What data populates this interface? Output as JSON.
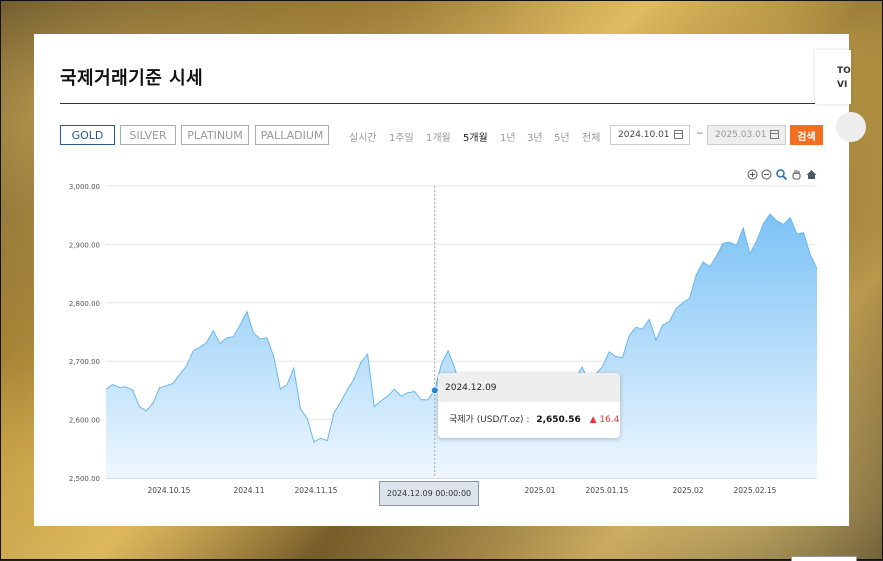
{
  "page": {
    "title": "국제거래기준 시세"
  },
  "metals": [
    {
      "label": "GOLD",
      "active": true
    },
    {
      "label": "SILVER",
      "active": false
    },
    {
      "label": "PLATINUM",
      "active": false
    },
    {
      "label": "PALLADIUM",
      "active": false
    }
  ],
  "periods": [
    {
      "label": "실시간",
      "active": false
    },
    {
      "label": "1주일",
      "active": false
    },
    {
      "label": "1개월",
      "active": false
    },
    {
      "label": "5개월",
      "active": true
    },
    {
      "label": "1년",
      "active": false
    },
    {
      "label": "3년",
      "active": false
    },
    {
      "label": "5년",
      "active": false
    },
    {
      "label": "전체",
      "active": false
    }
  ],
  "date_range": {
    "start": "2024.10.01",
    "end": "2025.03.01",
    "separator": "~"
  },
  "search_label": "검색",
  "side_card": {
    "line1": "TO",
    "line2": "VI"
  },
  "toolbar_icons": [
    "zoom-in-icon",
    "zoom-out-icon",
    "magnify-icon",
    "pan-hand-icon",
    "home-icon"
  ],
  "tooltip": {
    "date": "2024.12.09",
    "label": "국제가 (USD/T.oz)",
    "separator": ":",
    "value": "2,650.56",
    "arrow": "▲",
    "change": "16.4"
  },
  "crosshair_label": "2024.12.09 00:00:00",
  "colors": {
    "accent": "#f26f21",
    "active_tab": "#2c5a88",
    "area_top": "#7cc2f5",
    "area_bottom": "#eef7fe",
    "line": "#6ab7f0",
    "up": "#e53935"
  },
  "chart_data": {
    "type": "area",
    "ylim": [
      2500,
      3000
    ],
    "yticks": [
      "3,000.00",
      "2,900.00",
      "2,800.00",
      "2,700.00",
      "2,600.00",
      "2,500.00"
    ],
    "xticks": [
      "2024.10.15",
      "2024.11",
      "2024.11.15",
      "2024.12.09 00:00:00",
      "2025.01",
      "2025.01.15",
      "2025.02",
      "2025.02.15"
    ],
    "grid": true,
    "series": [
      {
        "x": [
          "2024.10.01",
          "2024.10.02",
          "2024.10.03",
          "2024.10.04",
          "2024.10.07",
          "2024.10.08",
          "2024.10.09",
          "2024.10.10",
          "2024.10.11",
          "2024.10.14",
          "2024.10.15",
          "2024.10.16",
          "2024.10.17",
          "2024.10.18",
          "2024.10.21",
          "2024.10.22",
          "2024.10.23",
          "2024.10.24",
          "2024.10.25",
          "2024.10.28",
          "2024.10.29",
          "2024.10.30",
          "2024.10.31",
          "2024.11.01",
          "2024.11.04",
          "2024.11.05",
          "2024.11.06",
          "2024.11.07",
          "2024.11.08",
          "2024.11.11",
          "2024.11.12",
          "2024.11.13",
          "2024.11.14",
          "2024.11.15",
          "2024.11.18",
          "2024.11.19",
          "2024.11.20",
          "2024.11.21",
          "2024.11.22",
          "2024.11.25",
          "2024.11.26",
          "2024.11.27",
          "2024.11.28",
          "2024.11.29",
          "2024.12.02",
          "2024.12.03",
          "2024.12.04",
          "2024.12.05",
          "2024.12.06",
          "2024.12.09",
          "2024.12.10",
          "2024.12.11",
          "2024.12.12",
          "2024.12.13",
          "2024.12.16",
          "2024.12.17",
          "2024.12.18",
          "2024.12.19",
          "2024.12.20",
          "2024.12.23",
          "2024.12.24",
          "2024.12.26",
          "2024.12.27",
          "2024.12.30",
          "2024.12.31",
          "2025.01.02",
          "2025.01.03",
          "2025.01.06",
          "2025.01.07",
          "2025.01.08",
          "2025.01.09",
          "2025.01.10",
          "2025.01.13",
          "2025.01.14",
          "2025.01.15",
          "2025.01.16",
          "2025.01.17",
          "2025.01.20",
          "2025.01.21",
          "2025.01.22",
          "2025.01.23",
          "2025.01.24",
          "2025.01.27",
          "2025.01.28",
          "2025.01.29",
          "2025.01.30",
          "2025.01.31",
          "2025.02.03",
          "2025.02.04",
          "2025.02.05",
          "2025.02.06",
          "2025.02.07",
          "2025.02.10",
          "2025.02.11",
          "2025.02.12",
          "2025.02.13",
          "2025.02.14",
          "2025.02.17",
          "2025.02.18",
          "2025.02.19",
          "2025.02.20",
          "2025.02.21",
          "2025.02.24",
          "2025.02.25",
          "2025.02.26",
          "2025.02.27",
          "2025.02.28"
        ],
        "values": [
          2652,
          2660,
          2655,
          2656,
          2650,
          2622,
          2615,
          2628,
          2655,
          2658,
          2662,
          2678,
          2692,
          2718,
          2724,
          2732,
          2752,
          2730,
          2740,
          2742,
          2762,
          2785,
          2748,
          2738,
          2740,
          2708,
          2652,
          2660,
          2688,
          2618,
          2602,
          2562,
          2568,
          2564,
          2612,
          2630,
          2652,
          2670,
          2698,
          2712,
          2622,
          2632,
          2640,
          2652,
          2640,
          2646,
          2648,
          2634,
          2634,
          2650,
          2695,
          2718,
          2688,
          2648,
          2652,
          2648,
          2605,
          2612,
          2622,
          2618,
          2615,
          2634,
          2618,
          2608,
          2624,
          2660,
          2642,
          2632,
          2655,
          2662,
          2672,
          2690,
          2664,
          2678,
          2690,
          2716,
          2708,
          2706,
          2744,
          2758,
          2755,
          2772,
          2736,
          2762,
          2768,
          2790,
          2800,
          2808,
          2848,
          2870,
          2862,
          2880,
          2902,
          2904,
          2898,
          2928,
          2884,
          2906,
          2935,
          2952,
          2940,
          2934,
          2946,
          2918,
          2920,
          2882,
          2858
        ]
      }
    ]
  }
}
